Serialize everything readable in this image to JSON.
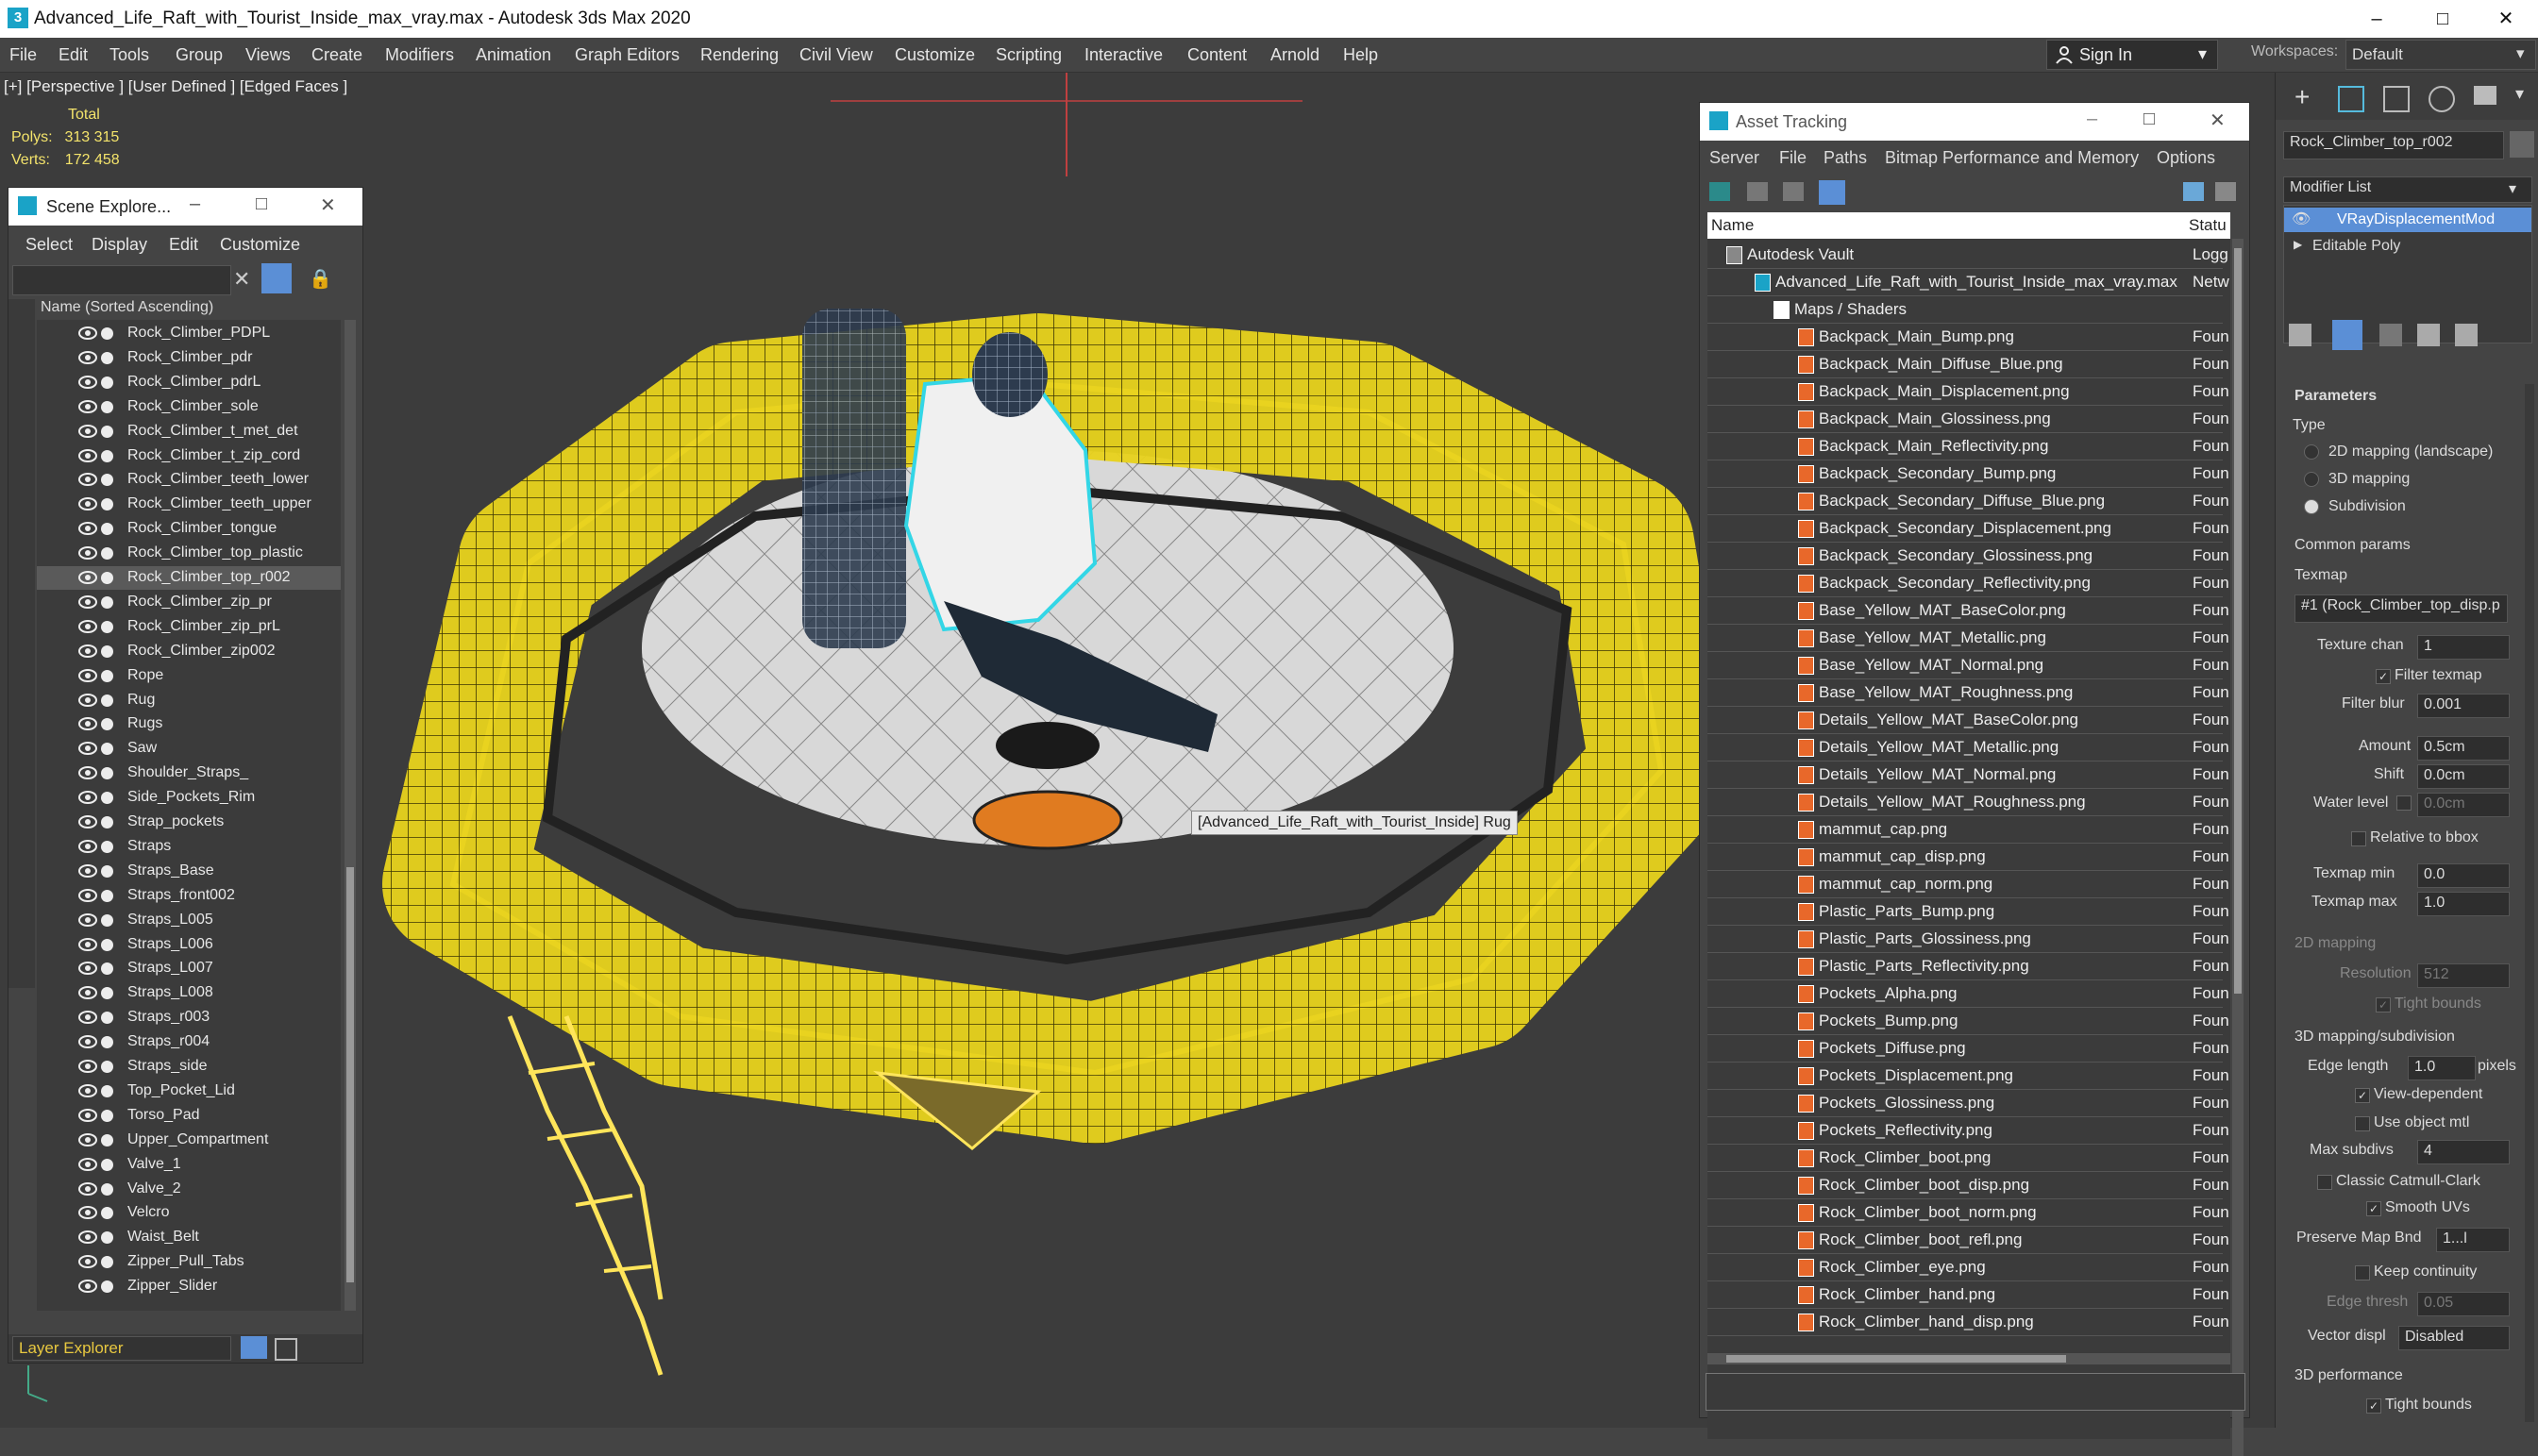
{
  "window": {
    "title": "Advanced_Life_Raft_with_Tourist_Inside_max_vray.max - Autodesk 3ds Max 2020"
  },
  "menu": [
    "File",
    "Edit",
    "Tools",
    "Group",
    "Views",
    "Create",
    "Modifiers",
    "Animation",
    "Graph Editors",
    "Rendering",
    "Civil View",
    "Customize",
    "Scripting",
    "Interactive",
    "Content",
    "Arnold",
    "Help"
  ],
  "signin": "Sign In",
  "workspaces": {
    "label": "Workspaces:",
    "value": "Default"
  },
  "viewport": {
    "label": "[+] [Perspective ] [User Defined ] [Edged Faces ]",
    "stats_total": "Total",
    "polys_label": "Polys:",
    "polys": "313 315",
    "verts_label": "Verts:",
    "verts": "172 458",
    "tooltip": "[Advanced_Life_Raft_with_Tourist_Inside] Rug"
  },
  "scene_explorer": {
    "title": "Scene Explore...",
    "menu": [
      "Select",
      "Display",
      "Edit",
      "Customize"
    ],
    "column": "Name (Sorted Ascending)",
    "selected": "Rock_Climber_top_r002",
    "items": [
      "Rock_Climber_PDPL",
      "Rock_Climber_pdr",
      "Rock_Climber_pdrL",
      "Rock_Climber_sole",
      "Rock_Climber_t_met_det",
      "Rock_Climber_t_zip_cord",
      "Rock_Climber_teeth_lower",
      "Rock_Climber_teeth_upper",
      "Rock_Climber_tongue",
      "Rock_Climber_top_plastic",
      "Rock_Climber_top_r002",
      "Rock_Climber_zip_pr",
      "Rock_Climber_zip_prL",
      "Rock_Climber_zip002",
      "Rope",
      "Rug",
      "Rugs",
      "Saw",
      "Shoulder_Straps_",
      "Side_Pockets_Rim",
      "Strap_pockets",
      "Straps",
      "Straps_Base",
      "Straps_front002",
      "Straps_L005",
      "Straps_L006",
      "Straps_L007",
      "Straps_L008",
      "Straps_r003",
      "Straps_r004",
      "Straps_side",
      "Top_Pocket_Lid",
      "Torso_Pad",
      "Upper_Compartment",
      "Valve_1",
      "Valve_2",
      "Velcro",
      "Waist_Belt",
      "Zipper_Pull_Tabs",
      "Zipper_Slider"
    ],
    "footer": "Layer Explorer"
  },
  "asset_tracking": {
    "title": "Asset Tracking",
    "menu": [
      "Server",
      "File",
      "Paths",
      "Bitmap Performance and Memory",
      "Options"
    ],
    "col_name": "Name",
    "col_status": "Statu",
    "vault": {
      "name": "Autodesk Vault",
      "status": "Logg"
    },
    "file": {
      "name": "Advanced_Life_Raft_with_Tourist_Inside_max_vray.max",
      "status": "Netw"
    },
    "maps_folder": "Maps / Shaders",
    "found": "Foun",
    "maps": [
      "Backpack_Main_Bump.png",
      "Backpack_Main_Diffuse_Blue.png",
      "Backpack_Main_Displacement.png",
      "Backpack_Main_Glossiness.png",
      "Backpack_Main_Reflectivity.png",
      "Backpack_Secondary_Bump.png",
      "Backpack_Secondary_Diffuse_Blue.png",
      "Backpack_Secondary_Displacement.png",
      "Backpack_Secondary_Glossiness.png",
      "Backpack_Secondary_Reflectivity.png",
      "Base_Yellow_MAT_BaseColor.png",
      "Base_Yellow_MAT_Metallic.png",
      "Base_Yellow_MAT_Normal.png",
      "Base_Yellow_MAT_Roughness.png",
      "Details_Yellow_MAT_BaseColor.png",
      "Details_Yellow_MAT_Metallic.png",
      "Details_Yellow_MAT_Normal.png",
      "Details_Yellow_MAT_Roughness.png",
      "mammut_cap.png",
      "mammut_cap_disp.png",
      "mammut_cap_norm.png",
      "Plastic_Parts_Bump.png",
      "Plastic_Parts_Glossiness.png",
      "Plastic_Parts_Reflectivity.png",
      "Pockets_Alpha.png",
      "Pockets_Bump.png",
      "Pockets_Diffuse.png",
      "Pockets_Displacement.png",
      "Pockets_Glossiness.png",
      "Pockets_Reflectivity.png",
      "Rock_Climber_boot.png",
      "Rock_Climber_boot_disp.png",
      "Rock_Climber_boot_norm.png",
      "Rock_Climber_boot_refl.png",
      "Rock_Climber_eye.png",
      "Rock_Climber_hand.png",
      "Rock_Climber_hand_disp.png"
    ]
  },
  "command_panel": {
    "object_name": "Rock_Climber_top_r002",
    "modifier_list": "Modifier List",
    "stack": [
      "VRayDisplacementMod",
      "Editable Poly"
    ],
    "parameters": "Parameters",
    "type_label": "Type",
    "type_options": [
      "2D mapping (landscape)",
      "3D mapping",
      "Subdivision"
    ],
    "common_params": "Common params",
    "texmap_label": "Texmap",
    "texmap_value": "#1 (Rock_Climber_top_disp.p",
    "texture_chan": {
      "label": "Texture chan",
      "value": "1"
    },
    "filter_texmap": "Filter texmap",
    "filter_blur": {
      "label": "Filter blur",
      "value": "0.001"
    },
    "amount": {
      "label": "Amount",
      "value": "0.5cm"
    },
    "shift": {
      "label": "Shift",
      "value": "0.0cm"
    },
    "water_level": {
      "label": "Water level",
      "value": "0.0cm"
    },
    "relative_bbox": "Relative to bbox",
    "texmap_min": {
      "label": "Texmap min",
      "value": "0.0"
    },
    "texmap_max": {
      "label": "Texmap max",
      "value": "1.0"
    },
    "mapping2d": "2D mapping",
    "resolution": {
      "label": "Resolution",
      "value": "512"
    },
    "tight_bounds_2d": "Tight bounds",
    "mapping3d": "3D mapping/subdivision",
    "edge_length": {
      "label": "Edge length",
      "value": "1.0",
      "unit": "pixels"
    },
    "view_dependent": "View-dependent",
    "use_object_mtl": "Use object mtl",
    "max_subdivs": {
      "label": "Max subdivs",
      "value": "4"
    },
    "classic_catmull": "Classic Catmull-Clark",
    "smooth_uvs": "Smooth UVs",
    "preserve_map": {
      "label": "Preserve Map Bnd",
      "value": "1...l"
    },
    "keep_continuity": "Keep continuity",
    "edge_thresh": {
      "label": "Edge thresh",
      "value": "0.05"
    },
    "vector_displ": {
      "label": "Vector displ",
      "value": "Disabled"
    },
    "perf3d": "3D performance",
    "tight_bounds_3d": "Tight bounds"
  }
}
